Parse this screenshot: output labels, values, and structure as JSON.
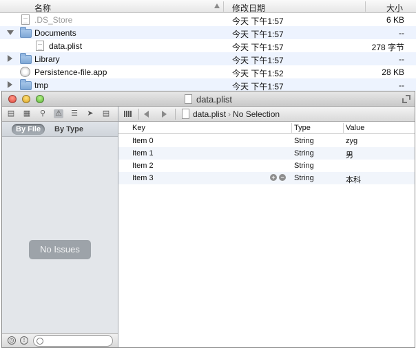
{
  "finder": {
    "columns": {
      "name": "名称",
      "modified": "修改日期",
      "size": "大小"
    },
    "rows": [
      {
        "name": ".DS_Store",
        "date": "今天 下午1:57",
        "size": "6 KB",
        "icon": "document-icon",
        "disclosure": "none",
        "indent": 1,
        "dimmed": true
      },
      {
        "name": "Documents",
        "date": "今天 下午1:57",
        "size": "--",
        "icon": "folder-icon",
        "disclosure": "open",
        "indent": 1,
        "dimmed": false
      },
      {
        "name": "data.plist",
        "date": "今天 下午1:57",
        "size": "278 字节",
        "icon": "document-icon",
        "disclosure": "none",
        "indent": 2,
        "dimmed": false
      },
      {
        "name": "Library",
        "date": "今天 下午1:57",
        "size": "--",
        "icon": "folder-icon",
        "disclosure": "closed",
        "indent": 1,
        "dimmed": false
      },
      {
        "name": "Persistence-file.app",
        "date": "今天 下午1:52",
        "size": "28 KB",
        "icon": "app-icon",
        "disclosure": "none",
        "indent": 1,
        "dimmed": false
      },
      {
        "name": "tmp",
        "date": "今天 下午1:57",
        "size": "--",
        "icon": "folder-icon",
        "disclosure": "closed",
        "indent": 1,
        "dimmed": false
      }
    ]
  },
  "window": {
    "title": "data.plist"
  },
  "navigator": {
    "scope_by_file": "By File",
    "scope_by_type": "By Type",
    "empty_message": "No Issues",
    "filter_placeholder": ""
  },
  "jumpbar": {
    "file": "data.plist",
    "selection": "No Selection"
  },
  "plist": {
    "headers": {
      "key": "Key",
      "type": "Type",
      "value": "Value"
    },
    "rows": [
      {
        "key": "Item 0",
        "type": "String",
        "value": "zyg"
      },
      {
        "key": "Item 1",
        "type": "String",
        "value": "男"
      },
      {
        "key": "Item 2",
        "type": "String",
        "value": ""
      },
      {
        "key": "Item 3",
        "type": "String",
        "value": "本科"
      }
    ],
    "add_symbol": "+",
    "remove_symbol": "−"
  }
}
